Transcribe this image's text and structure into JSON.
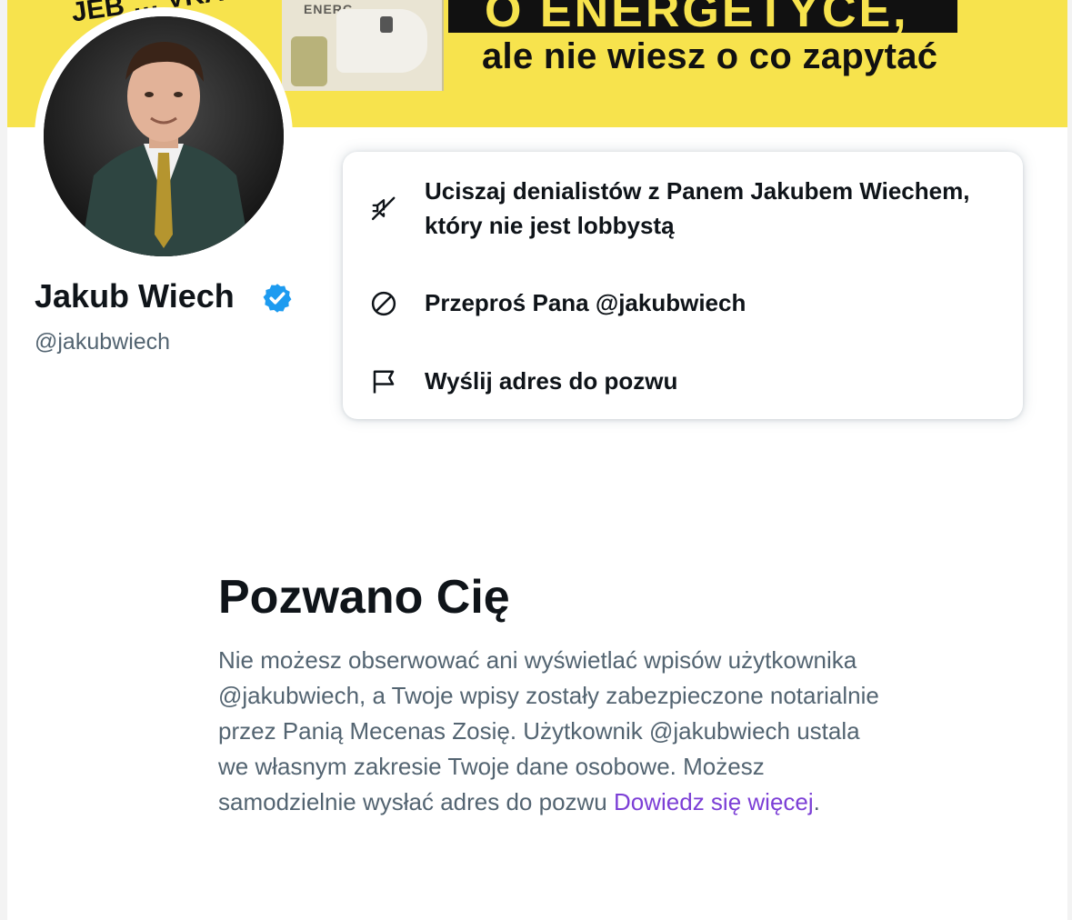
{
  "banner": {
    "headline": "O ENERGETYCE,",
    "subline": "ale nie wiesz o co zapytać",
    "accent_color": "#f7e34d"
  },
  "profile": {
    "name": "Jakub Wiech",
    "handle": "@jakubwiech",
    "verified": true,
    "verified_color": "#1d9bf0"
  },
  "menu": {
    "items": [
      {
        "icon": "mute-icon",
        "label": "Uciszaj denialistów z Panem Jakubem Wiechem, który nie jest lobbystą"
      },
      {
        "icon": "block-icon",
        "label": "Przeproś Pana @jakubwiech"
      },
      {
        "icon": "flag-icon",
        "label": "Wyślij adres do pozwu"
      }
    ]
  },
  "notice": {
    "title": "Pozwano Cię",
    "body": "Nie możesz obserwować ani wyświetlać wpisów użytkownika @jakubwiech, a Twoje wpisy zostały zabezpieczone notarialnie przez Panią Mecenas Zosię. Użytkownik @jakubwiech ustala we własnym zakresie Twoje dane osobowe. Możesz samodzielnie wysłać adres do pozwu ",
    "link_text": "Dowiedz się więcej",
    "link_suffix": ".",
    "link_color": "#7c3fd6"
  }
}
